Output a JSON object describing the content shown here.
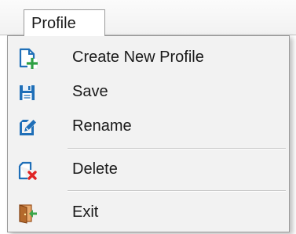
{
  "menu": {
    "title": "Profile",
    "items": [
      {
        "label": "Create New Profile",
        "icon": "create-profile-icon"
      },
      {
        "label": "Save",
        "icon": "save-floppy-icon"
      },
      {
        "label": "Rename",
        "icon": "rename-pencil-icon"
      },
      {
        "label": "Delete",
        "icon": "delete-profile-icon"
      },
      {
        "label": "Exit",
        "icon": "exit-door-icon"
      }
    ]
  },
  "colors": {
    "icon_blue": "#1f6fb8",
    "create_green": "#2ea043",
    "delete_red": "#e02424",
    "exit_green": "#3aa64a",
    "door_brown": "#b4692c"
  }
}
